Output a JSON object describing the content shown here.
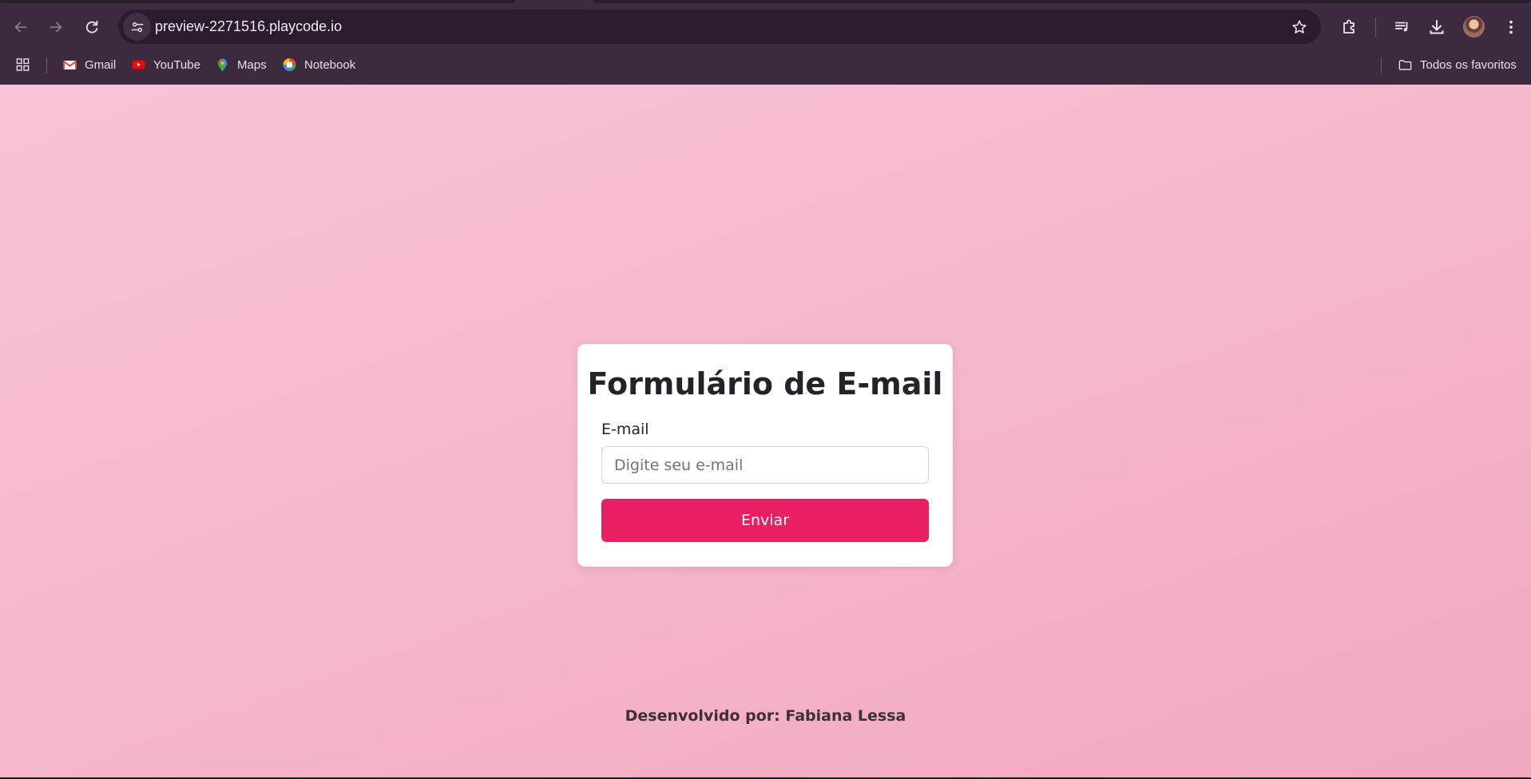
{
  "browser": {
    "url": "preview-2271516.playcode.io",
    "bookmarks": [
      {
        "label": "Gmail",
        "icon": "gmail-icon"
      },
      {
        "label": "YouTube",
        "icon": "youtube-icon"
      },
      {
        "label": "Maps",
        "icon": "maps-icon"
      },
      {
        "label": "Notebook",
        "icon": "notebook-icon"
      }
    ],
    "all_bookmarks_label": "Todos os favoritos",
    "colors": {
      "chrome": "#3c2a3e",
      "omnibox": "#2a1b2d"
    }
  },
  "form": {
    "title": "Formulário de E-mail",
    "email_label": "E-mail",
    "email_value": "",
    "email_placeholder": "Digite seu e-mail",
    "submit_label": "Enviar",
    "colors": {
      "button": "#e91e63",
      "card": "#ffffff"
    }
  },
  "footer": {
    "text": "Desenvolvido por: Fabiana Lessa"
  },
  "page": {
    "colors": {
      "background_start": "#f8c4d7",
      "background_end": "#f2a9bd"
    }
  }
}
